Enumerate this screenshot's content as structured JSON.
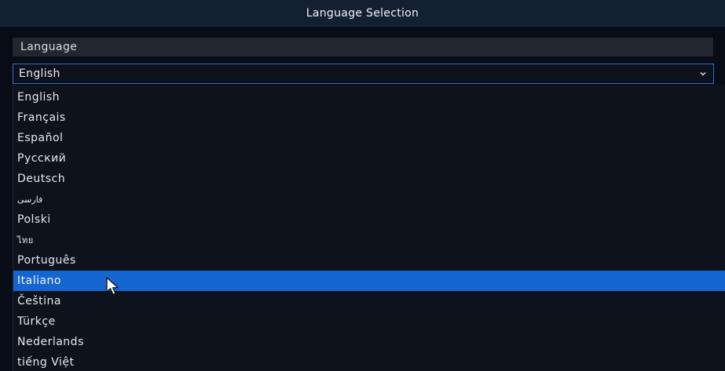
{
  "dialog": {
    "title": "Language Selection"
  },
  "section": {
    "label": "Language"
  },
  "select": {
    "value": "English",
    "chevron_icon": "chevron-down-icon"
  },
  "options": [
    {
      "label": "English",
      "selected": false
    },
    {
      "label": "Français",
      "selected": false
    },
    {
      "label": "Español",
      "selected": false
    },
    {
      "label": "Русский",
      "selected": false
    },
    {
      "label": "Deutsch",
      "selected": false
    },
    {
      "label": "فارسی",
      "selected": false
    },
    {
      "label": "Polski",
      "selected": false
    },
    {
      "label": "ไทย",
      "selected": false
    },
    {
      "label": "Português",
      "selected": false
    },
    {
      "label": "Italiano",
      "selected": true
    },
    {
      "label": "Čeština",
      "selected": false
    },
    {
      "label": "Türkçe",
      "selected": false
    },
    {
      "label": "Nederlands",
      "selected": false
    },
    {
      "label": "tiếng Việt",
      "selected": false
    }
  ],
  "colors": {
    "accent": "#1565d0",
    "border": "#2f6fc2",
    "background": "#080c16"
  },
  "cursor_icon": "mouse-pointer-icon"
}
